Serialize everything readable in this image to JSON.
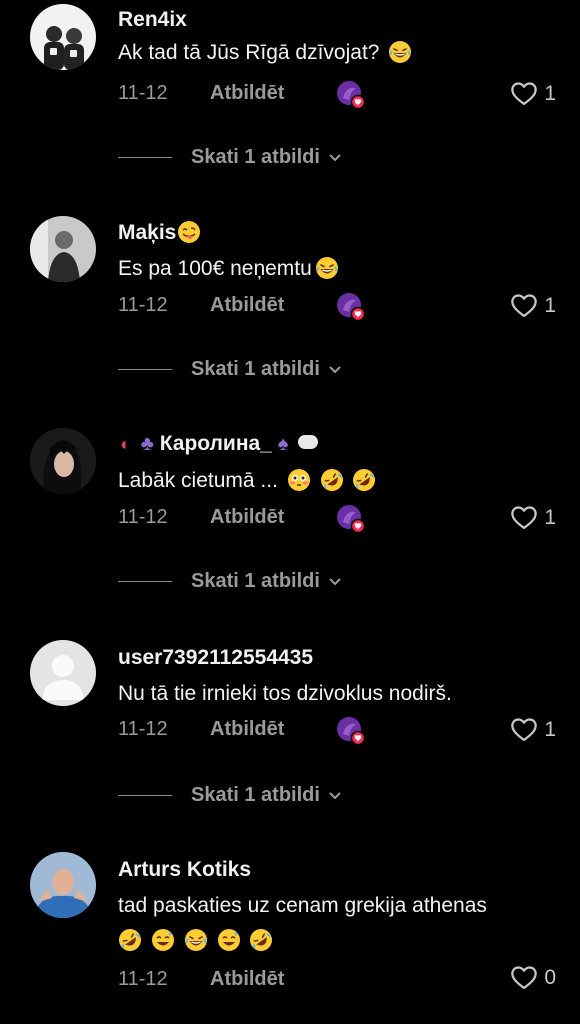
{
  "comments": [
    {
      "username": "Ren4ix",
      "text": "Ak tad tā Jūs Rīgā dzīvojat?",
      "emojis": [
        "laughing-emoji"
      ],
      "date": "11-12",
      "reply_label": "Atbildēt",
      "likes": "1",
      "view_replies": "Skati 1 atbildi",
      "creator_liked": true
    },
    {
      "username": "Maķis",
      "username_emojis": [
        "grinning-tongue-emoji"
      ],
      "text": "Es pa 100€ neņemtu",
      "emojis": [
        "laughing-emoji"
      ],
      "date": "11-12",
      "reply_label": "Atbildēt",
      "likes": "1",
      "view_replies": "Skati 1 atbildi",
      "creator_liked": true
    },
    {
      "username": "Каролина_",
      "username_prefix_icons": [
        "fan-icon",
        "club-icon"
      ],
      "username_suffix_icons": [
        "spade-icon",
        "speech-bubble-icon"
      ],
      "text": "Labāk cietumā ...",
      "emojis": [
        "flushed-emoji",
        "rofl-emoji",
        "rofl-emoji"
      ],
      "date": "11-12",
      "reply_label": "Atbildēt",
      "likes": "1",
      "view_replies": "Skati 1 atbildi",
      "creator_liked": true
    },
    {
      "username": "user7392112554435",
      "text": "Nu tā tie irnieki tos dzivoklus nodirš.",
      "emojis": [],
      "date": "11-12",
      "reply_label": "Atbildēt",
      "likes": "1",
      "view_replies": "Skati 1 atbildi",
      "creator_liked": true
    },
    {
      "username": "Arturs Kotiks",
      "text": "tad paskaties uz cenam grekija athenas",
      "emojis_line2": [
        "rofl-emoji",
        "sweat-smile-emoji",
        "laughing-emoji",
        "sweat-smile-emoji",
        "rofl-emoji"
      ],
      "date": "11-12",
      "reply_label": "Atbildēt",
      "likes": "0",
      "creator_liked": false
    }
  ],
  "colors": {
    "background": "#000000",
    "muted_text": "#9a9a9a",
    "creator_badge": "#7b3fb0",
    "heart_badge": "#fe2c55"
  }
}
